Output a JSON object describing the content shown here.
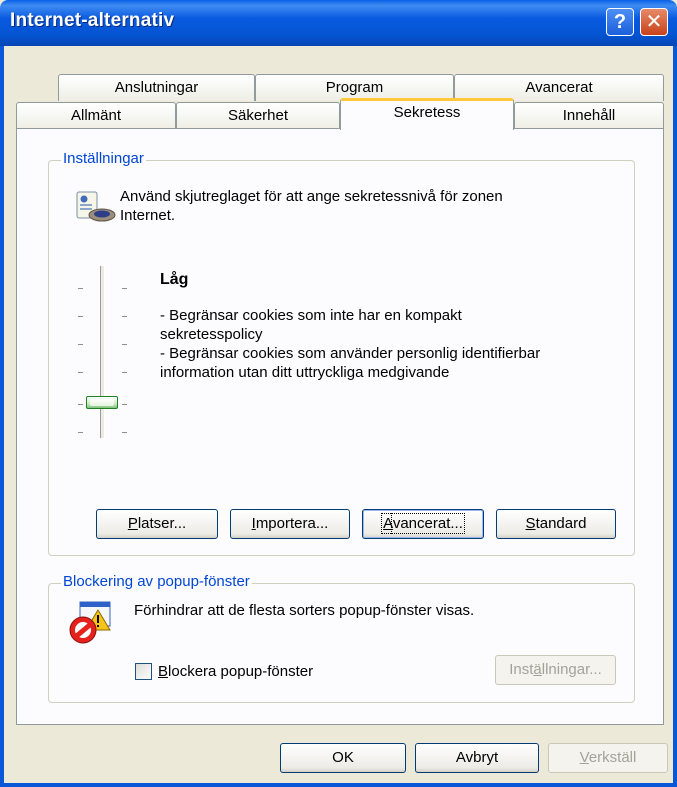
{
  "window": {
    "title": "Internet-alternativ",
    "help_label": "?",
    "close_label": "✕"
  },
  "tabs_row_back": [
    {
      "label": "Anslutningar"
    },
    {
      "label": "Program"
    },
    {
      "label": "Avancerat"
    }
  ],
  "tabs_row_front": [
    {
      "label": "Allmänt"
    },
    {
      "label": "Säkerhet"
    },
    {
      "label": "Sekretess",
      "active": true
    },
    {
      "label": "Innehåll"
    }
  ],
  "settings": {
    "group_label": "Inställningar",
    "description_line1": "Använd skjutreglaget för att ange sekretessnivå för zonen",
    "description_line2": "Internet.",
    "slider_level": "2 of 6 (Låg)",
    "level_name": "Låg",
    "details": [
      "- Begränsar cookies som inte har en kompakt",
      "sekretesspolicy",
      "- Begränsar cookies som använder personlig identifierbar",
      "information utan ditt uttryckliga medgivande"
    ],
    "buttons": {
      "sites": {
        "accel": "P",
        "rest": "latser..."
      },
      "import": {
        "accel": "I",
        "rest": "mportera..."
      },
      "advanced": {
        "accel": "A",
        "rest": "vancerat..."
      },
      "default": {
        "accel": "S",
        "rest": "tandard"
      }
    }
  },
  "popup": {
    "group_label": "Blockering av popup-fönster",
    "description": "Förhindrar att de flesta sorters popup-fönster visas.",
    "checkbox_accel": "B",
    "checkbox_rest": "lockera popup-fönster",
    "checkbox_checked": false,
    "settings_button": {
      "pre": "Inst",
      "accel": "ä",
      "rest": "llningar..."
    }
  },
  "footer": {
    "ok": "OK",
    "cancel": "Avbryt",
    "apply_accel": "V",
    "apply_rest": "erkställ"
  },
  "colors": {
    "title_blue": "#0454D3",
    "group_label_blue": "#0046D5",
    "active_tab_accent": "#FFC83C"
  }
}
